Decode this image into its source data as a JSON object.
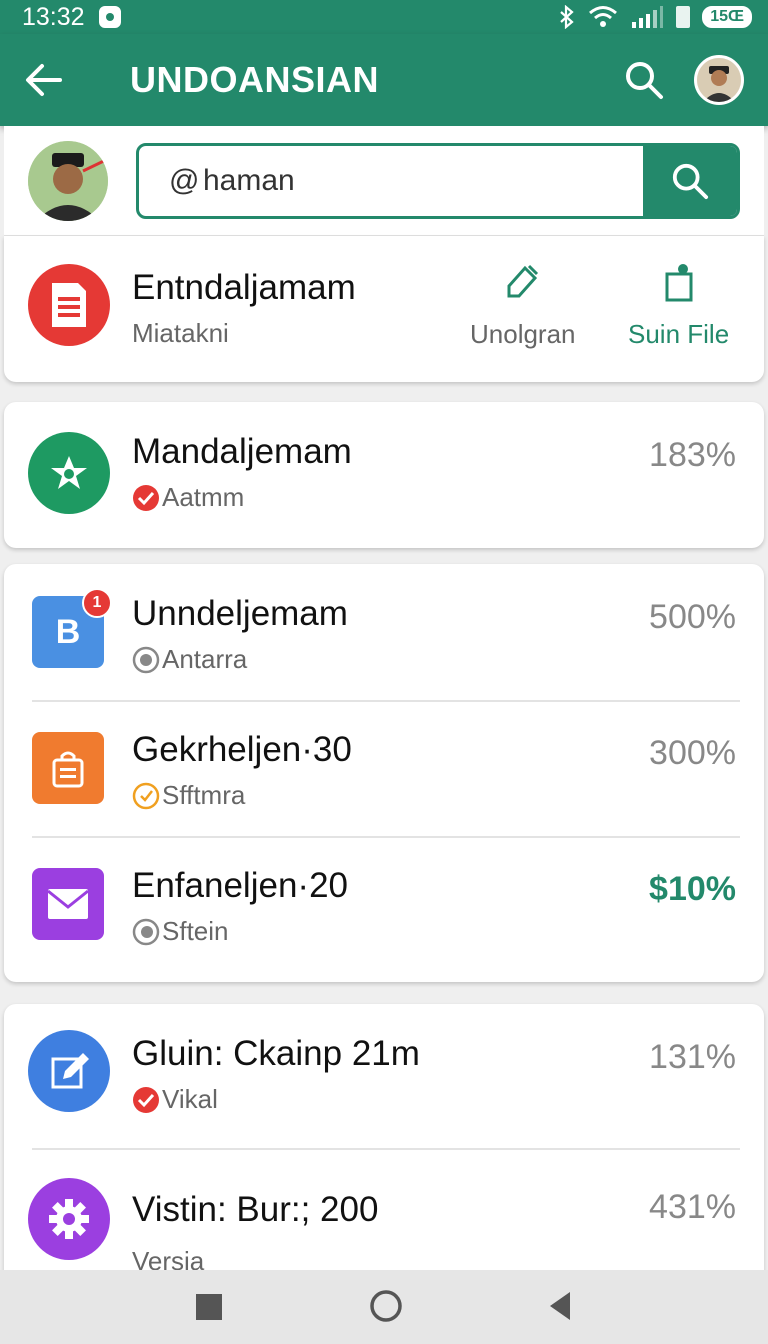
{
  "status_bar": {
    "time": "13:32",
    "battery_label": "15Œ"
  },
  "app_bar": {
    "title": "UNDOANSIAN"
  },
  "search": {
    "query": "haman",
    "prefix": "@"
  },
  "header_item": {
    "title": "Entndaljamam",
    "subtitle": "Miatakni",
    "actions": [
      {
        "label": "Unolgran"
      },
      {
        "label": "Suin File"
      }
    ]
  },
  "items": [
    {
      "title": "Mandaljemam",
      "subtitle": "Aatmm",
      "percent": "183%"
    },
    {
      "title": "Unndeljemam",
      "subtitle": "Antarra",
      "percent": "500%",
      "badge": "1",
      "icon_letter": "B"
    },
    {
      "title": "Gekrheljen·30",
      "subtitle": "Sfftmra",
      "percent": "300%"
    },
    {
      "title": "Enfaneljen·20",
      "subtitle": "Sftein",
      "percent": "$10%"
    },
    {
      "title": "Gluin: Ckainp 21m",
      "subtitle": "Vikal",
      "percent": "131%"
    },
    {
      "title": "Vistin: Bur:; 200",
      "subtitle": "Versia",
      "percent": "431%"
    }
  ],
  "colors": {
    "primary": "#23896b",
    "red": "#e53935",
    "green": "#1e9a62",
    "blue": "#3f7fe0",
    "orange": "#f07b2f",
    "purple": "#9b3fe0"
  }
}
